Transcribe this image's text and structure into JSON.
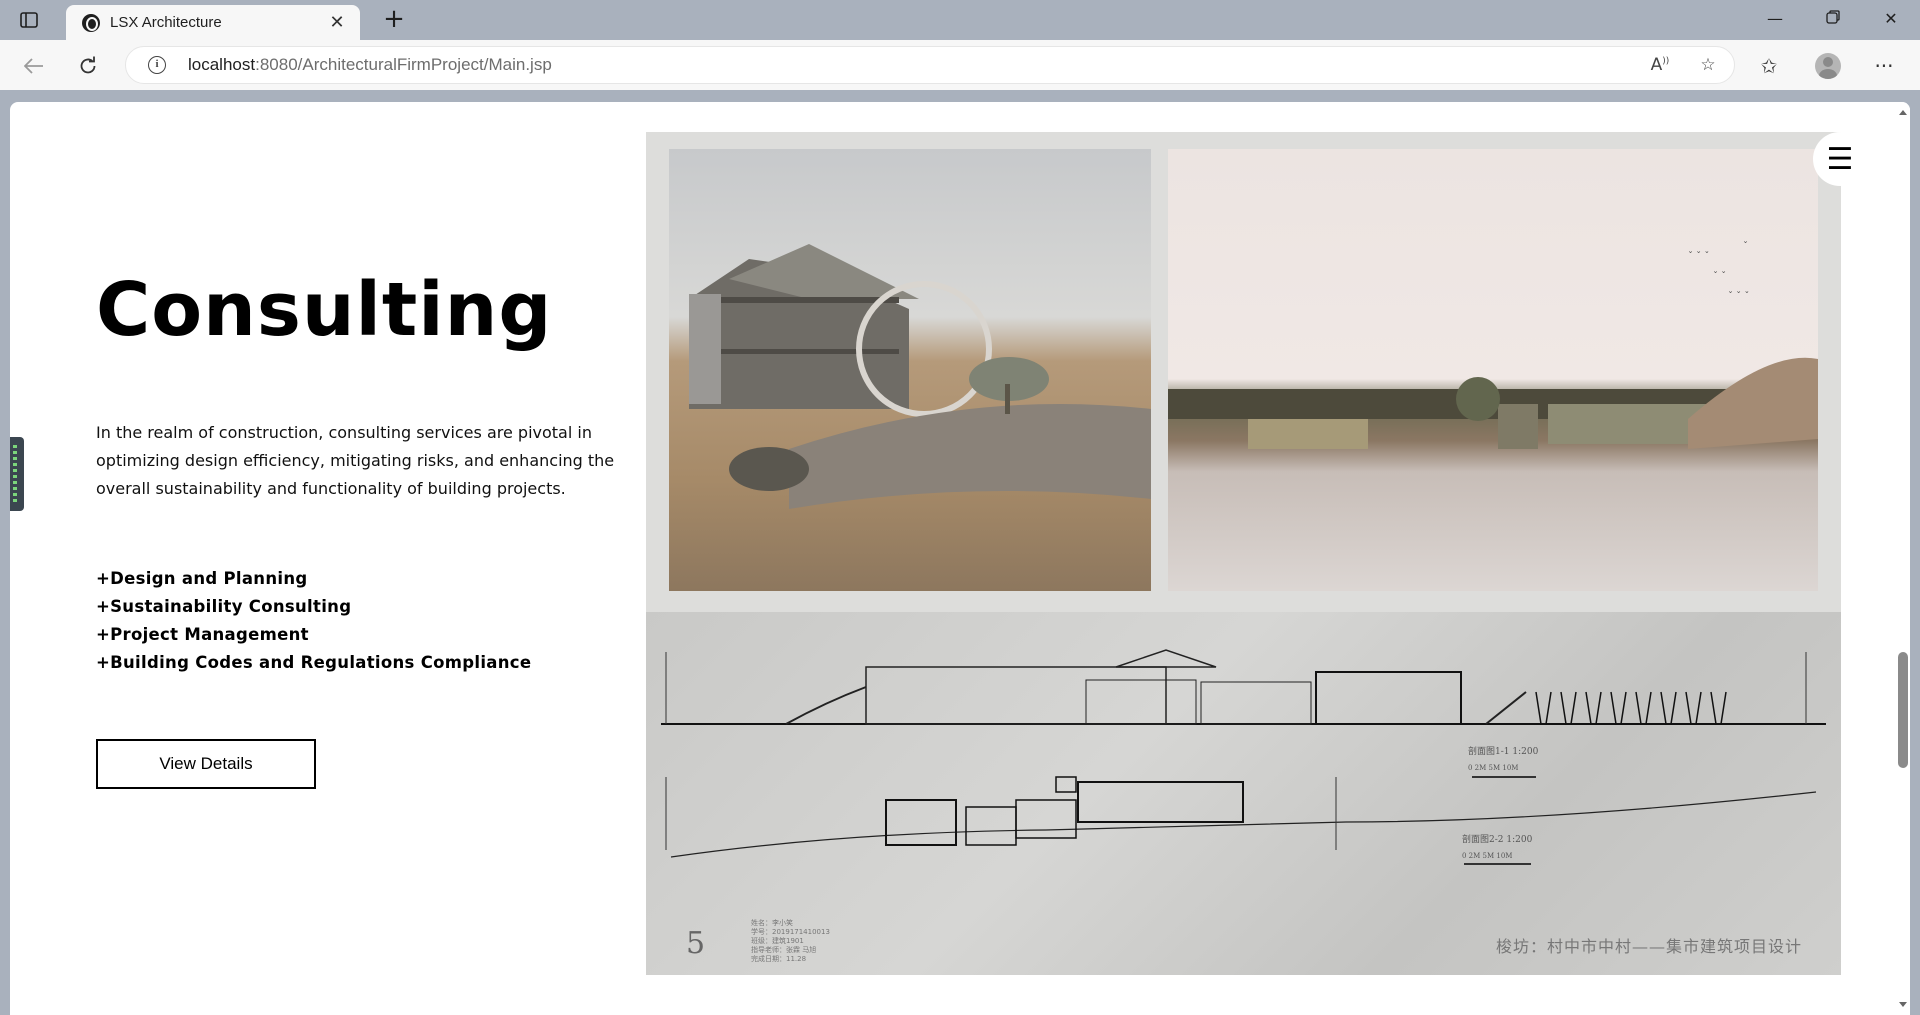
{
  "browser": {
    "tab_title": "LSX Architecture",
    "url_host": "localhost",
    "url_path": ":8080/ArchitecturalFirmProject/Main.jsp",
    "icons": [
      "tab-actions-icon",
      "favicon-icon",
      "close-icon",
      "new-tab-icon",
      "minimize-icon",
      "restore-icon",
      "window-close-icon",
      "back-icon",
      "reload-icon",
      "info-icon",
      "read-aloud-icon",
      "add-favorite-icon",
      "favorites-icon",
      "profile-icon",
      "more-icon"
    ]
  },
  "section": {
    "title": "Consulting",
    "description": "In the realm of construction, consulting services are pivotal in optimizing design efficiency, mitigating risks, and enhancing the overall sustainability and functionality of building projects.",
    "services": [
      "+Design and Planning",
      "+Sustainability Consulting",
      "+Project Management",
      "+Building Codes and Regulations Compliance"
    ],
    "button_label": "View Details"
  },
  "board": {
    "page_number": "5",
    "meta_lines": [
      "姓名：李小笑",
      "学号：2019171410013",
      "班级：建筑1901",
      "指导老师：张霖 马旭",
      "完成日期：11.28"
    ],
    "title": "梭坊：村中市中村——集市建筑项目设计",
    "scale_1": "剖面图1-1 1:200",
    "scale_2": "剖面图2-2 1:200",
    "scale_ticks": "0  2M  5M        10M"
  },
  "menu_icon": "hamburger-icon"
}
